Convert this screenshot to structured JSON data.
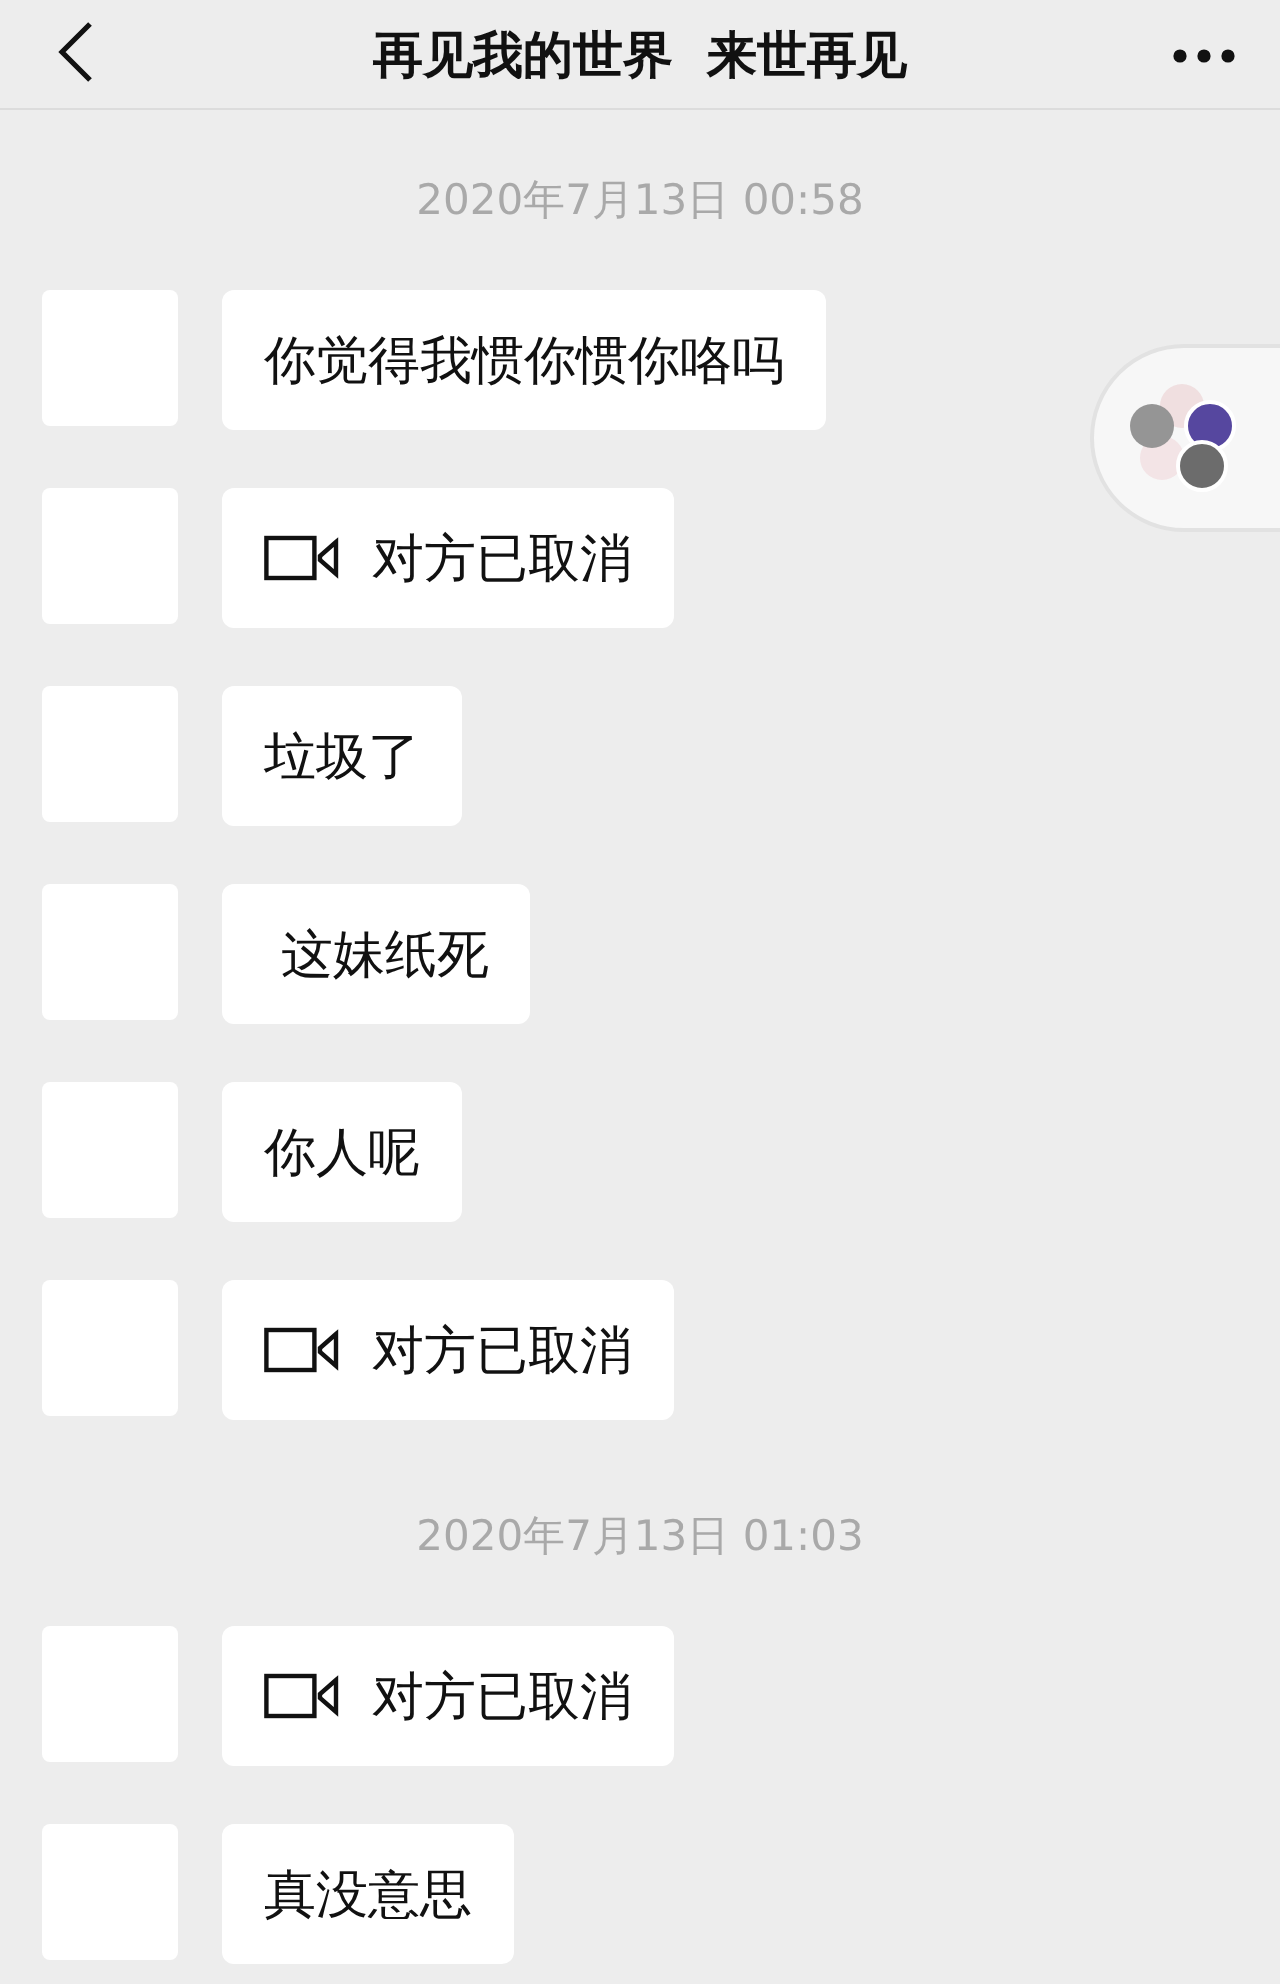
{
  "header": {
    "title": "再见我的世界  来世再见"
  },
  "sections": [
    {
      "timestamp": "2020年7月13日 00:58",
      "messages": [
        {
          "kind": "text",
          "text": "你觉得我惯你惯你咯吗"
        },
        {
          "kind": "video_call",
          "text": "对方已取消"
        },
        {
          "kind": "text",
          "text": "垃圾了"
        },
        {
          "kind": "text",
          "text": " 这妹纸死"
        },
        {
          "kind": "text",
          "text": "你人呢"
        },
        {
          "kind": "video_call",
          "text": "对方已取消"
        }
      ]
    },
    {
      "timestamp": "2020年7月13日 01:03",
      "messages": [
        {
          "kind": "video_call",
          "text": "对方已取消"
        },
        {
          "kind": "text",
          "text": "真没意思"
        }
      ]
    }
  ]
}
